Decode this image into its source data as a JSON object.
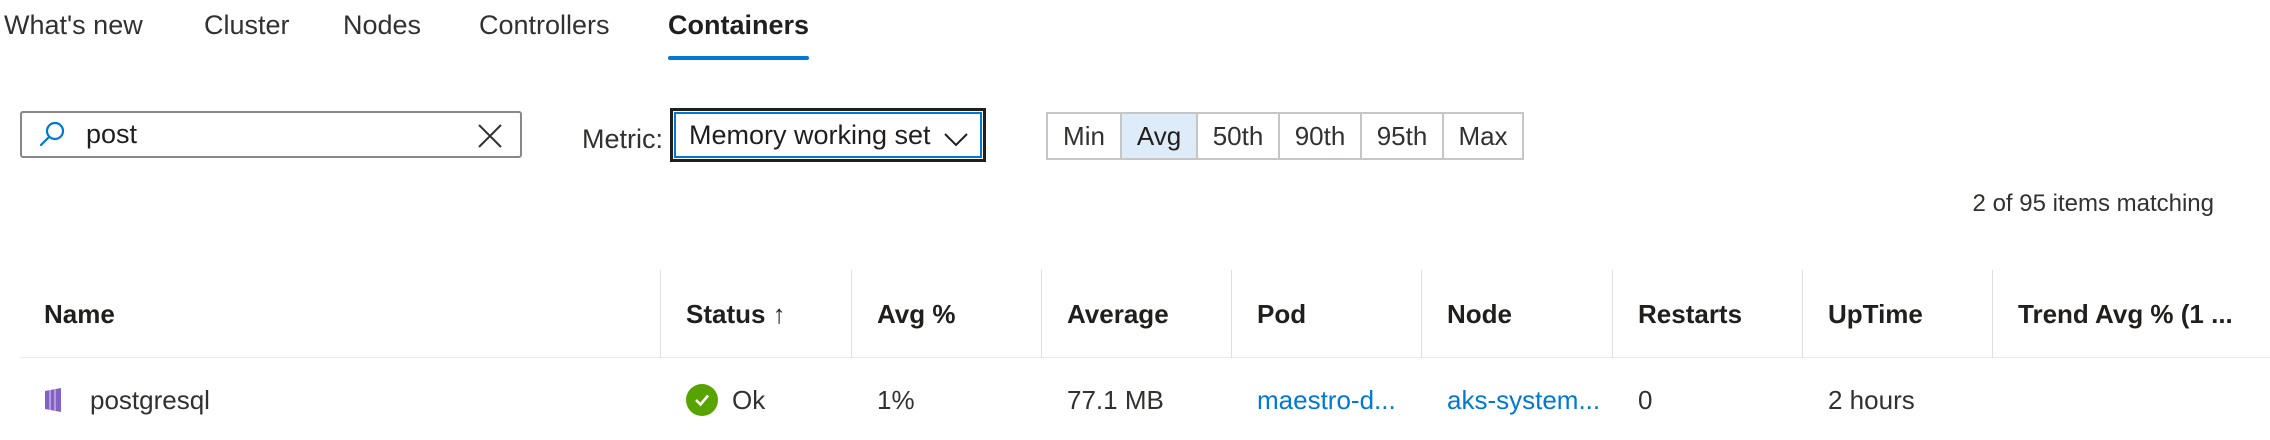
{
  "tabs": [
    {
      "label": "What's new",
      "active": false
    },
    {
      "label": "Cluster",
      "active": false
    },
    {
      "label": "Nodes",
      "active": false
    },
    {
      "label": "Controllers",
      "active": false
    },
    {
      "label": "Containers",
      "active": true
    }
  ],
  "search": {
    "value": "post",
    "icon": "search-icon",
    "clear_icon": "close-icon"
  },
  "metric": {
    "label": "Metric:",
    "selected": "Memory working set",
    "icon": "chevron-down-icon"
  },
  "aggregations": [
    {
      "label": "Min",
      "active": false
    },
    {
      "label": "Avg",
      "active": true
    },
    {
      "label": "50th",
      "active": false
    },
    {
      "label": "90th",
      "active": false
    },
    {
      "label": "95th",
      "active": false
    },
    {
      "label": "Max",
      "active": false
    }
  ],
  "match_text": "2 of 95 items matching",
  "table": {
    "columns": [
      "Name",
      "Status ↑",
      "Avg %",
      "Average",
      "Pod",
      "Node",
      "Restarts",
      "UpTime",
      "Trend Avg % (1 ..."
    ],
    "rows": [
      {
        "icon": "container-icon",
        "name": "postgresql",
        "status_icon": "check-circle-icon",
        "status": "Ok",
        "avg_pct": "1%",
        "average": "77.1 MB",
        "pod": "maestro-d...",
        "node": "aks-system...",
        "restarts": "0",
        "uptime": "2 hours",
        "trend": ""
      }
    ]
  },
  "colors": {
    "accent": "#0078d4",
    "ok": "#57a300",
    "selected_bg": "#deecf9",
    "container_icon": "#8661c5"
  }
}
